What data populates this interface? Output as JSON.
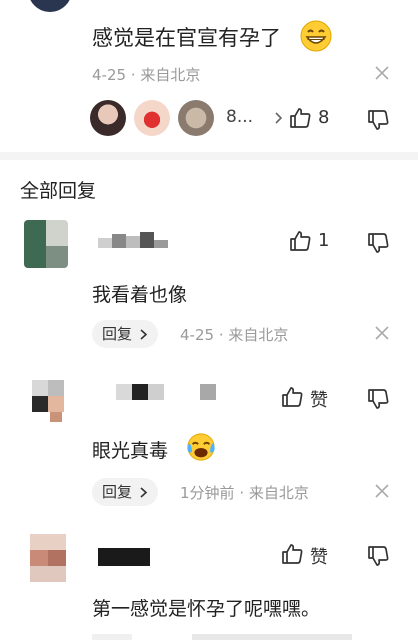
{
  "parent": {
    "text": "感觉是在官宣有孕了",
    "date": "4-25",
    "location": "来自北京",
    "reactor_more": "8...",
    "like_count": "8"
  },
  "section_title": "全部回复",
  "replies": [
    {
      "text": "我看着也像",
      "like_count": "1",
      "reply_label": "回复",
      "time": "4-25",
      "location": "来自北京"
    },
    {
      "text": "眼光真毒",
      "like_label": "赞",
      "reply_label": "回复",
      "time": "1分钟前",
      "location": "来自北京"
    },
    {
      "text": "第一感觉是怀孕了呢嘿嘿。",
      "like_label": "赞"
    }
  ],
  "icons": {
    "grin_emoji": "grinning-face-icon",
    "cry_emoji": "tears-of-joy-icon",
    "like": "thumbs-up-icon",
    "dislike": "thumbs-down-icon",
    "close": "close-icon",
    "chevron": "chevron-right-icon"
  },
  "colors": {
    "text": "#222222",
    "muted": "#9a9a9a",
    "pill_bg": "#f2f2f2",
    "divider": "#f4f4f4"
  }
}
